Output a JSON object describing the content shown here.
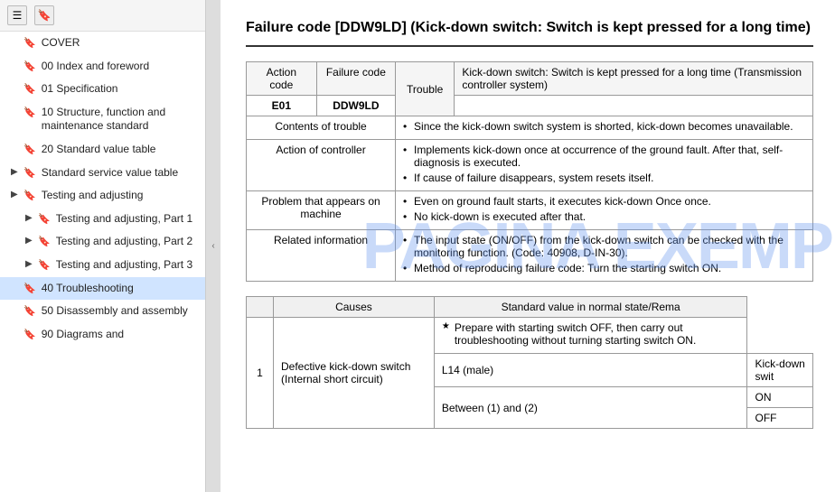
{
  "sidebar": {
    "toolbar": {
      "icon1": "☰",
      "icon2": "🔖"
    },
    "items": [
      {
        "id": "cover",
        "label": "COVER",
        "hasArrow": false,
        "indent": 0
      },
      {
        "id": "00-index",
        "label": "00 Index and foreword",
        "hasArrow": false,
        "indent": 0
      },
      {
        "id": "01-spec",
        "label": "01 Specification",
        "hasArrow": false,
        "indent": 0
      },
      {
        "id": "10-structure",
        "label": "10 Structure, function and maintenance standard",
        "hasArrow": false,
        "indent": 0
      },
      {
        "id": "20-standard",
        "label": "20 Standard value table",
        "hasArrow": false,
        "indent": 0
      },
      {
        "id": "standard-service",
        "label": "Standard service value table",
        "hasArrow": true,
        "indent": 0
      },
      {
        "id": "testing-adjusting",
        "label": "Testing and adjusting",
        "hasArrow": true,
        "indent": 0
      },
      {
        "id": "testing-part1",
        "label": "Testing and adjusting, Part 1",
        "hasArrow": true,
        "indent": 1
      },
      {
        "id": "testing-part2",
        "label": "Testing and adjusting, Part 2",
        "hasArrow": true,
        "indent": 1
      },
      {
        "id": "testing-part3",
        "label": "Testing and adjusting, Part 3",
        "hasArrow": true,
        "indent": 1
      },
      {
        "id": "40-troubleshooting",
        "label": "40 Troubleshooting",
        "hasArrow": false,
        "indent": 0,
        "active": true
      },
      {
        "id": "50-disassembly",
        "label": "50 Disassembly and assembly",
        "hasArrow": false,
        "indent": 0
      },
      {
        "id": "90-diagrams",
        "label": "90 Diagrams and",
        "hasArrow": false,
        "indent": 0
      }
    ]
  },
  "page": {
    "title": "Failure code [DDW9LD] (Kick-down switch: Switch is kept pressed for a long time)"
  },
  "info_table": {
    "headers": [
      "Action code",
      "Failure code",
      "Trouble"
    ],
    "action_code": "E01",
    "failure_code": "DDW9LD",
    "trouble": "Kick-down switch: Switch is kept pressed for a long time (Transmission controller system)",
    "rows": [
      {
        "label": "Contents of trouble",
        "content": "Since the kick-down switch system is shorted, kick-down becomes unavailable."
      },
      {
        "label": "Action of controller",
        "bullets": [
          "Implements kick-down once at occurrence of the ground fault. After that, self-diagnosis is executed.",
          "If cause of failure disappears, system resets itself."
        ]
      },
      {
        "label": "Problem that appears on machine",
        "bullets": [
          "Even on ground fault starts, it executes kick-down Once once.",
          "No kick-down is executed after that."
        ]
      },
      {
        "label": "Related information",
        "bullets": [
          "The input state (ON/OFF) from the kick-down switch can be checked with the monitoring function. (Code: 40908, D-IN-30).",
          "Method of reproducing failure code: Turn the starting switch ON."
        ]
      }
    ]
  },
  "causes_table": {
    "col1": "Causes",
    "col2": "Standard value in normal state/Rema",
    "rows": [
      {
        "num": "1",
        "cause": "Defective kick-down switch (Internal short circuit)",
        "prepare_note": "★ Prepare with starting switch OFF, then carry out troubleshooting without turning starting switch ON.",
        "sub_rows": [
          {
            "label": "L14 (male)",
            "value": "Kick-down swit"
          },
          {
            "label": "Between (1) and (2)",
            "on": "ON",
            "off": "OFF"
          }
        ]
      }
    ]
  },
  "watermark": {
    "text": "PAGINA EXEMPLU"
  },
  "collapse_btn": "‹"
}
